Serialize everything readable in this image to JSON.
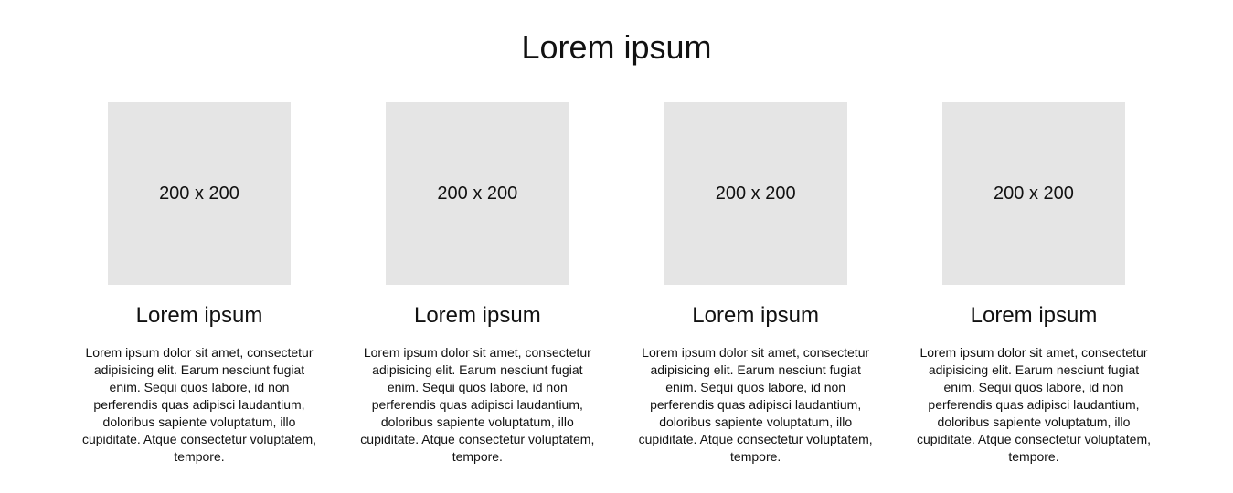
{
  "page": {
    "title": "Lorem ipsum"
  },
  "cards": [
    {
      "image_label": "200 x 200",
      "title": "Lorem ipsum",
      "text": "Lorem ipsum dolor sit amet, consectetur adipisicing elit. Earum nesciunt fugiat enim. Sequi quos labore, id non perferendis quas adipisci laudantium, doloribus sapiente voluptatum, illo cupiditate. Atque consectetur voluptatem, tempore."
    },
    {
      "image_label": "200 x 200",
      "title": "Lorem ipsum",
      "text": "Lorem ipsum dolor sit amet, consectetur adipisicing elit. Earum nesciunt fugiat enim. Sequi quos labore, id non perferendis quas adipisci laudantium, doloribus sapiente voluptatum, illo cupiditate. Atque consectetur voluptatem, tempore."
    },
    {
      "image_label": "200 x 200",
      "title": "Lorem ipsum",
      "text": "Lorem ipsum dolor sit amet, consectetur adipisicing elit. Earum nesciunt fugiat enim. Sequi quos labore, id non perferendis quas adipisci laudantium, doloribus sapiente voluptatum, illo cupiditate. Atque consectetur voluptatem, tempore."
    },
    {
      "image_label": "200 x 200",
      "title": "Lorem ipsum",
      "text": "Lorem ipsum dolor sit amet, consectetur adipisicing elit. Earum nesciunt fugiat enim. Sequi quos labore, id non perferendis quas adipisci laudantium, doloribus sapiente voluptatum, illo cupiditate. Atque consectetur voluptatem, tempore."
    }
  ],
  "colors": {
    "background": "#ffffff",
    "placeholder": "#e5e5e5",
    "text": "#111111"
  }
}
